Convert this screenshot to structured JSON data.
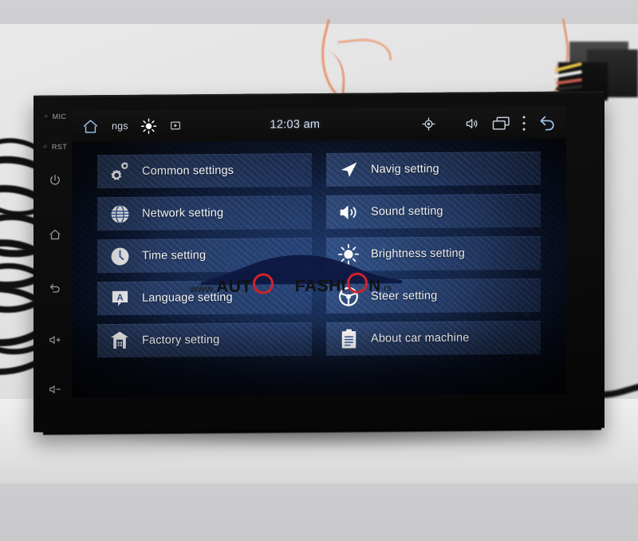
{
  "device": {
    "bezel_buttons": [
      {
        "name": "mic",
        "label": "MIC",
        "type": "hole"
      },
      {
        "name": "reset",
        "label": "RST",
        "type": "hole"
      },
      {
        "name": "power",
        "label": "",
        "type": "glyph"
      },
      {
        "name": "home",
        "label": "",
        "type": "glyph"
      },
      {
        "name": "back",
        "label": "",
        "type": "glyph"
      },
      {
        "name": "volume-up",
        "label": "+",
        "type": "glyph"
      },
      {
        "name": "volume-down",
        "label": "−",
        "type": "glyph"
      }
    ]
  },
  "statusbar": {
    "home_icon": "home-icon",
    "title": "ngs",
    "brightness_icon": "brightness-icon",
    "screenshot_icon": "screen-capture-icon",
    "clock": "12:03 am",
    "gps_icon": "gps-target-icon",
    "volume_icon": "volume-icon",
    "recents_icon": "recent-apps-icon",
    "overflow_icon": "more-vertical-icon",
    "back_icon": "back-arrow-icon"
  },
  "menu": {
    "items": [
      {
        "label": "Common settings",
        "icon": "gears-icon"
      },
      {
        "label": "Navig setting",
        "icon": "navigation-arrow-icon"
      },
      {
        "label": "Network setting",
        "icon": "globe-icon"
      },
      {
        "label": "Sound setting",
        "icon": "speaker-icon"
      },
      {
        "label": "Time setting",
        "icon": "clock-icon"
      },
      {
        "label": "Brightness setting",
        "icon": "brightness-sun-icon"
      },
      {
        "label": "Language setting",
        "icon": "language-a-icon"
      },
      {
        "label": "Steer setting",
        "icon": "steering-wheel-icon"
      },
      {
        "label": "Factory setting",
        "icon": "factory-house-icon"
      },
      {
        "label": "About car machine",
        "icon": "clipboard-icon"
      }
    ]
  },
  "watermark": {
    "prefix": "www.",
    "word_a": "AUT",
    "word_b": "FASHI",
    "word_c": "N",
    "suffix": ".rs"
  },
  "colors": {
    "tile_blue": "#5c82c4",
    "screen_blue": "#14274c",
    "status_bar": "#101010",
    "bezel": "#0b0b0b",
    "watermark_red": "#d0232b",
    "clock_text": "#dbe4f1"
  }
}
